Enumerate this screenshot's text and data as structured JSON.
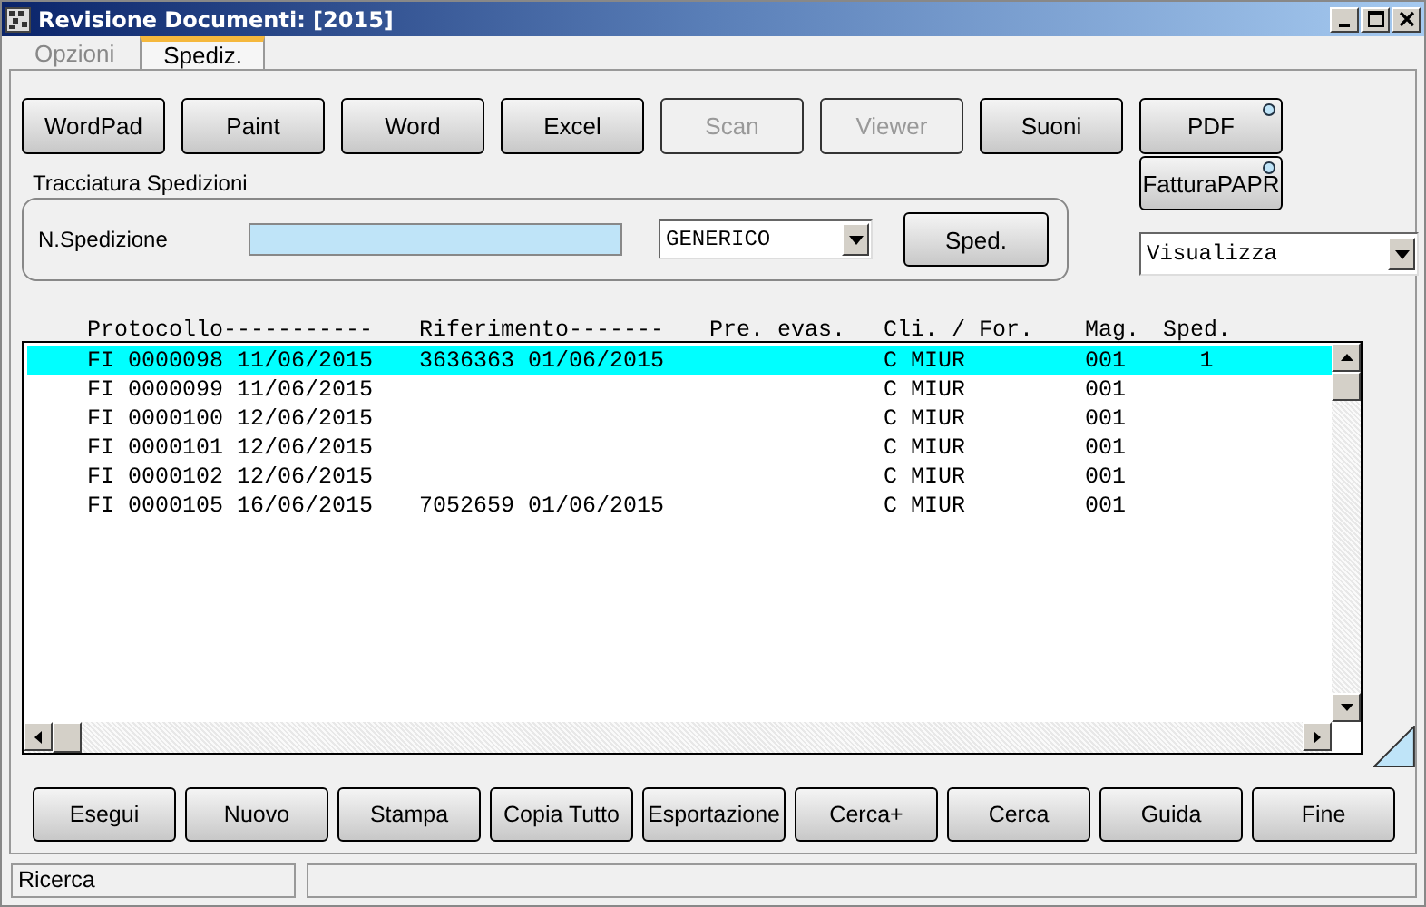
{
  "window": {
    "title": "Revisione Documenti: [2015]"
  },
  "tabs": [
    {
      "label": "Opzioni",
      "selected": false
    },
    {
      "label": "Spediz.",
      "selected": true
    }
  ],
  "toolbar": [
    {
      "label": "WordPad",
      "disabled": false
    },
    {
      "label": "Paint",
      "disabled": false
    },
    {
      "label": "Word",
      "disabled": false
    },
    {
      "label": "Excel",
      "disabled": false
    },
    {
      "label": "Scan",
      "disabled": true
    },
    {
      "label": "Viewer",
      "disabled": true
    },
    {
      "label": "Suoni",
      "disabled": false
    },
    {
      "label": "PDF",
      "disabled": false,
      "indicator": true
    }
  ],
  "extra_button": {
    "label": "FatturaPAPR",
    "indicator": true
  },
  "tracking": {
    "title": "Tracciatura Spedizioni",
    "label": "N.Spedizione",
    "type_value": "GENERICO",
    "button": "Sped."
  },
  "view_select": {
    "value": "Visualizza"
  },
  "list": {
    "columns": [
      "Protocollo-----------",
      "Riferimento-------",
      "Pre. evas.",
      "Cli. / For.",
      "Mag.",
      "Sped."
    ],
    "rows": [
      {
        "protocollo": "FI 0000098 11/06/2015",
        "riferimento": "3636363 01/06/2015",
        "cli_for": "C MIUR",
        "mag": "001",
        "sped": "1",
        "selected": true
      },
      {
        "protocollo": "FI 0000099 11/06/2015",
        "cli_for": "C MIUR",
        "mag": "001",
        "selected": false
      },
      {
        "protocollo": "FI 0000100 12/06/2015",
        "cli_for": "C MIUR",
        "mag": "001",
        "selected": false
      },
      {
        "protocollo": "FI 0000101 12/06/2015",
        "cli_for": "C MIUR",
        "mag": "001",
        "selected": false
      },
      {
        "protocollo": "FI 0000102 12/06/2015",
        "cli_for": "C MIUR",
        "mag": "001",
        "selected": false
      },
      {
        "protocollo": "FI 0000105 16/06/2015",
        "riferimento": "7052659 01/06/2015",
        "cli_for": "C MIUR",
        "mag": "001",
        "selected": false
      }
    ]
  },
  "actions": [
    {
      "label": "Esegui"
    },
    {
      "label": "Nuovo"
    },
    {
      "label": "Stampa"
    },
    {
      "label": "Copia Tutto"
    },
    {
      "label": "Esportazione"
    },
    {
      "label": "Cerca+"
    },
    {
      "label": "Cerca"
    },
    {
      "label": "Guida"
    },
    {
      "label": "Fine"
    }
  ],
  "status_bar": {
    "text": "Ricerca"
  }
}
